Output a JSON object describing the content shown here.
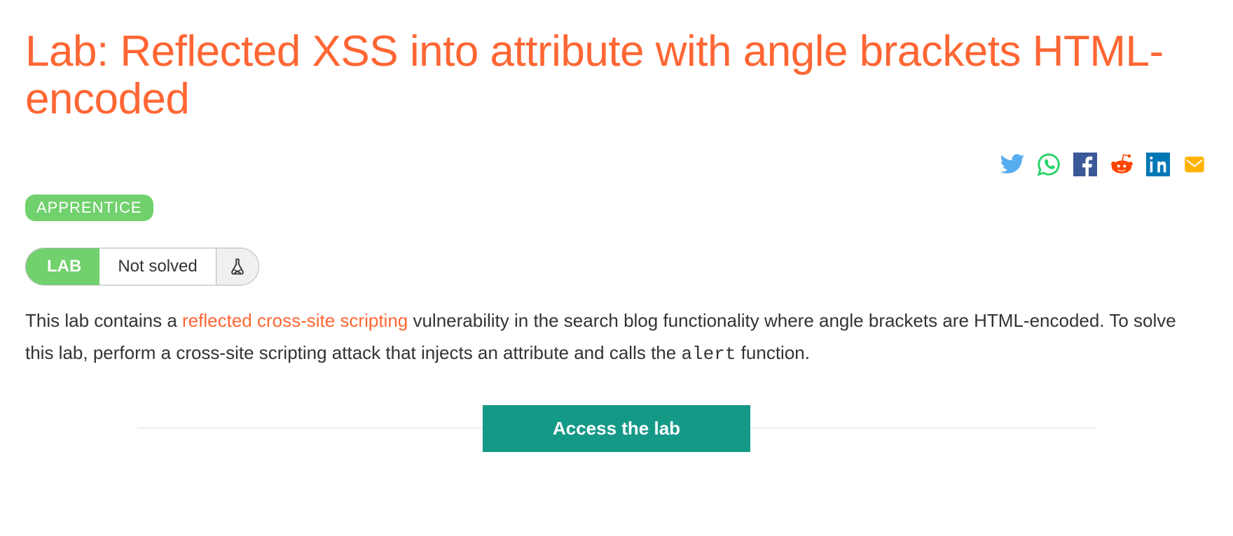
{
  "title": "Lab: Reflected XSS into attribute with angle brackets HTML-encoded",
  "share_icons": [
    "twitter",
    "whatsapp",
    "facebook",
    "reddit",
    "linkedin",
    "email"
  ],
  "level_badge": "APPRENTICE",
  "status": {
    "tag": "LAB",
    "state": "Not solved"
  },
  "description": {
    "pre_link": "This lab contains a ",
    "link_text": "reflected cross-site scripting",
    "post_link": " vulnerability in the search blog functionality where angle brackets are HTML-encoded. To solve this lab, perform a cross-site scripting attack that injects an attribute and calls the ",
    "code": "alert",
    "tail": " function."
  },
  "cta_label": "Access the lab"
}
